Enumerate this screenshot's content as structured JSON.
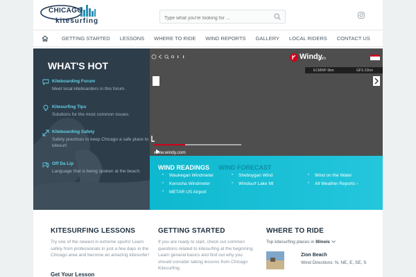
{
  "header": {
    "logo_top": "CHICAGO",
    "logo_bottom": "kitesurfing",
    "search_placeholder": "Type what you're looking for ...",
    "social_icon": "instagram-icon"
  },
  "nav": {
    "home_icon": "home-icon",
    "items": [
      "GETTING STARTED",
      "LESSONS",
      "WHERE TO RIDE",
      "WIND REPORTS",
      "GALLERY",
      "LOCAL RIDERS",
      "CONTACT US"
    ]
  },
  "whats_hot": {
    "title": "WHAT'S HOT",
    "items": [
      {
        "title": "Kiteboarding Forum",
        "desc": "Meet local kiteboarders in this forum.",
        "icon": "chat-icon"
      },
      {
        "title": "Kitesurfing Tips",
        "desc": "Solutions for the most common issues.",
        "icon": "lightbulb-icon"
      },
      {
        "title": "Kiteboarding Safety",
        "desc": "Safety practices to keep Chicago a safe place to kitesurf.",
        "icon": "safety-icon"
      },
      {
        "title": "Off Da Lip",
        "desc": "Language that is being spoken at the beach.",
        "icon": "speech-icon"
      }
    ]
  },
  "video": {
    "brand": "Windy",
    "brand_suffix": ".com",
    "model_left": "ECMWF 9km",
    "model_right": "GFS 22km",
    "url": "www.windy.com",
    "progress": 0.36
  },
  "wind": {
    "tab_active": "WIND READINGS",
    "tab_inactive": "WIND FORECAST",
    "links": [
      [
        "Waukegan Windmeter",
        "Sheboygan Wind",
        "Wind on the Water"
      ],
      [
        "Kenosha Windmeter",
        "Windsurf Lake MI",
        "All Weather Reports ›"
      ],
      [
        "METAR US Airport"
      ]
    ]
  },
  "lessons": {
    "title": "KITESURFING LESSONS",
    "body": "Try one of the newest in extreme sports! Learn safely from professionals in just a few days in the Chicago area and become an amazing kitesurfer!",
    "more": "Get Your Lesson"
  },
  "started": {
    "title": "GETTING STARTED",
    "body": "If you are ready to start, check out common questions related to kitesurfing at the beginning. Learn general basics and find out why you should consider taking lessons from Chicago Kitesurfing."
  },
  "ride": {
    "title": "WHERE TO RIDE",
    "sub_prefix": "Top kitesurfing places in",
    "sub_state": "Illinois",
    "spot_name": "Zion Beach",
    "spot_wind": "Wind Directions: N, NE, E, SE, S"
  },
  "colors": {
    "accent": "#1bbfd6",
    "dark_panel": "#2d3d4a",
    "link_blue": "#5fd0e6",
    "youtube_red": "#d0011b"
  }
}
